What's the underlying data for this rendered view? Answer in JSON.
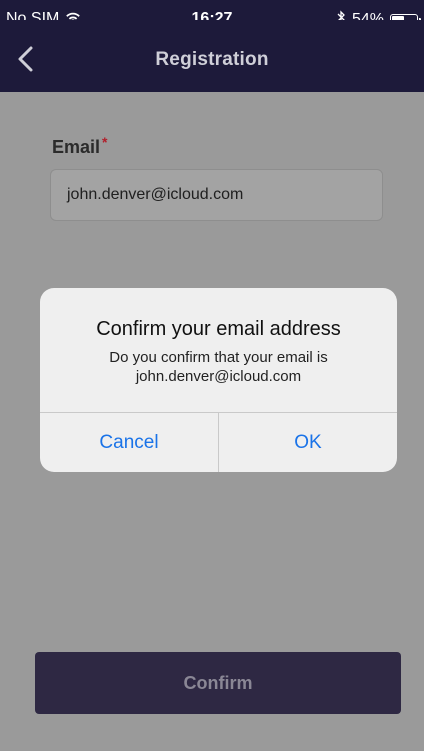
{
  "statusbar": {
    "carrier": "No SIM",
    "wifi_icon": "wifi-icon",
    "time": "16:27",
    "bluetooth_icon": "bluetooth-icon",
    "battery_percent": "54%",
    "battery_level": 0.54
  },
  "navbar": {
    "back_icon": "chevron-left-icon",
    "title": "Registration"
  },
  "form": {
    "email_label": "Email",
    "required_mark": "*",
    "email_value": "john.denver@icloud.com",
    "confirm_button": "Confirm"
  },
  "dialog": {
    "title": "Confirm your email address",
    "message_line1": "Do you confirm that your email is",
    "message_line2": "john.denver@icloud.com",
    "cancel_label": "Cancel",
    "ok_label": "OK"
  },
  "colors": {
    "nav_background": "#1d1a3a",
    "overlay_background": "#9a9a9a",
    "dialog_background": "#efefef",
    "dialog_button_text": "#1a73e8",
    "confirm_button_background": "#2e2843",
    "required_mark": "#b11f2b"
  }
}
